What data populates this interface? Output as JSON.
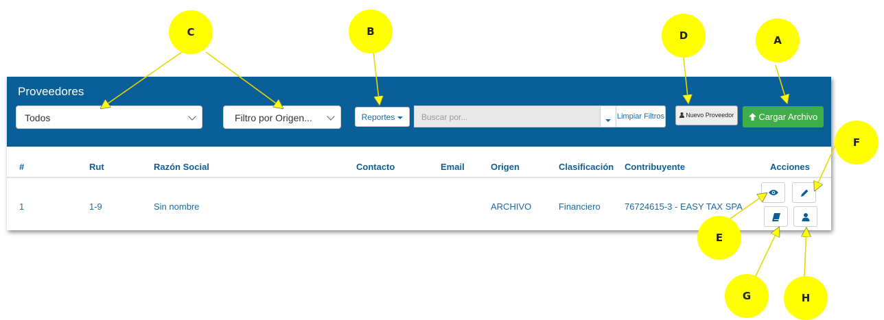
{
  "header": {
    "title": "Proveedores",
    "filter_estado": "Todos",
    "filter_origen": "Filtro por Origen...",
    "reportes_label": "Reportes",
    "search_placeholder": "Buscar por...",
    "limpiar_label": "Limpiar Filtros",
    "nuevo_label": "Nuevo Proveedor",
    "cargar_label": "Cargar Archivo"
  },
  "table": {
    "columns": [
      "#",
      "Rut",
      "Razón Social",
      "Contacto",
      "Email",
      "Origen",
      "Clasificación",
      "Contribuyente",
      "Acciones"
    ],
    "rows": [
      {
        "num": "1",
        "rut": "1-9",
        "razon": "Sin nombre",
        "contacto": "",
        "email": "",
        "origen": "ARCHIVO",
        "clasificacion": "Financiero",
        "contribuyente": "76724615-3 - EASY TAX SPA"
      }
    ]
  },
  "callouts": [
    "A",
    "B",
    "C",
    "D",
    "E",
    "F",
    "G",
    "H"
  ],
  "colors": {
    "header_bg": "#0b5f99",
    "success": "#3fae49",
    "callout": "#ffff00",
    "link": "#1a6aa5"
  }
}
